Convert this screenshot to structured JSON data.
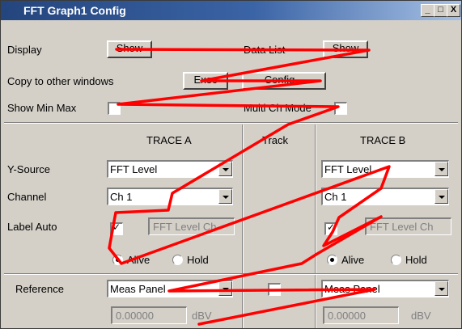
{
  "window": {
    "title": "FFT Graph1 Config",
    "controls": [
      "_",
      "□",
      "X"
    ]
  },
  "top": {
    "display_label": "Display",
    "display_button": "Show",
    "data_list_label": "Data List",
    "data_list_button": "Show",
    "copy_label": "Copy to other windows",
    "exec_button": "Exec",
    "config_button": "Config...",
    "min_max_label": "Show Min Max",
    "multi_ch_label": "Multi Ch Mode"
  },
  "columns": {
    "trace_a": "TRACE A",
    "track": "Track",
    "trace_b": "TRACE B"
  },
  "rows": {
    "y_source": "Y-Source",
    "channel": "Channel",
    "label_auto": "Label Auto",
    "reference": "Reference"
  },
  "trace_a": {
    "y_source": "FFT Level",
    "channel": "Ch 1",
    "label_text": "FFT Level Ch",
    "alive": "Alive",
    "hold": "Hold",
    "reference": "Meas Panel",
    "ref_value": "0.00000",
    "ref_unit": "dBV"
  },
  "trace_b": {
    "y_source": "FFT Level",
    "channel": "Ch 1",
    "label_text": "FFT Level Ch",
    "alive": "Alive",
    "hold": "Hold",
    "reference": "Meas Panel",
    "ref_value": "0.00000",
    "ref_unit": "dBV"
  },
  "colors": {
    "annotation_line": "#ff0000",
    "titlebar_start": "#24457d",
    "titlebar_end": "#a7c1e5",
    "panel": "#d4d0c8"
  }
}
